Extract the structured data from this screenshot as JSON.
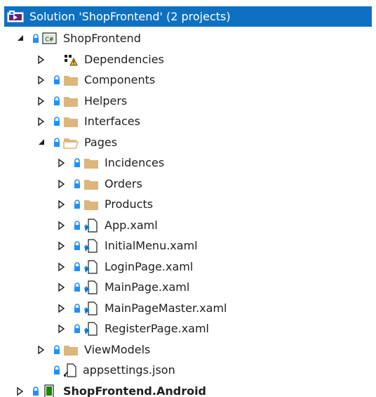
{
  "solution": {
    "label": "Solution 'ShopFrontend' (2 projects)"
  },
  "project": {
    "label": "ShopFrontend",
    "icon_text": "C#"
  },
  "items": {
    "dependencies": "Dependencies",
    "components": "Components",
    "helpers": "Helpers",
    "interfaces": "Interfaces",
    "pages": "Pages",
    "incidences": "Incidences",
    "orders": "Orders",
    "products": "Products",
    "app_xaml": "App.xaml",
    "initial_menu_xaml": "InitialMenu.xaml",
    "login_page_xaml": "LoginPage.xaml",
    "main_page_xaml": "MainPage.xaml",
    "main_page_master_xaml": "MainPageMaster.xaml",
    "register_page_xaml": "RegisterPage.xaml",
    "view_models": "ViewModels",
    "appsettings_json": "appsettings.json"
  },
  "android_project": {
    "label": "ShopFrontend.Android"
  },
  "colors": {
    "selection": "#0e70c0",
    "folder": "#dcb67a",
    "lock": "#1e90ff",
    "warning": "#f2c811",
    "csharp": "#178600",
    "xaml_blue": "#0078d4"
  }
}
